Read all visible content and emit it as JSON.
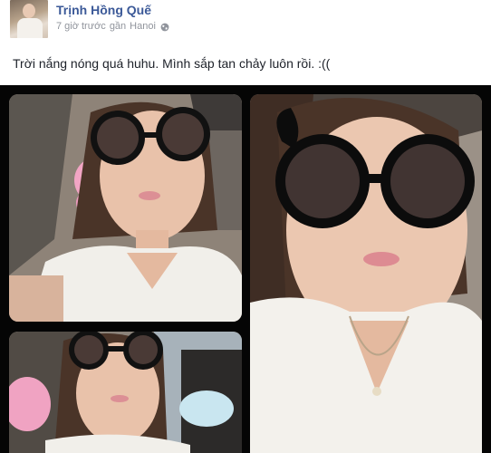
{
  "post": {
    "author": "Trịnh Hồng Quế",
    "time": "7 giờ trước",
    "location_prefix": "gần",
    "location": "Hanoi",
    "privacy_icon": "globe-icon",
    "status_text": "Trời nắng nóng quá huhu. Mình sắp tan chảy luôn rồi. :(("
  },
  "photos": [
    {
      "name": "photo-car-selfie-left"
    },
    {
      "name": "photo-car-selfie-right"
    },
    {
      "name": "photo-car-selfie-bottom"
    }
  ],
  "colors": {
    "author_link": "#3b5998",
    "meta_text": "#90949c",
    "body_text": "#1d2129",
    "collage_bg": "#050505"
  }
}
